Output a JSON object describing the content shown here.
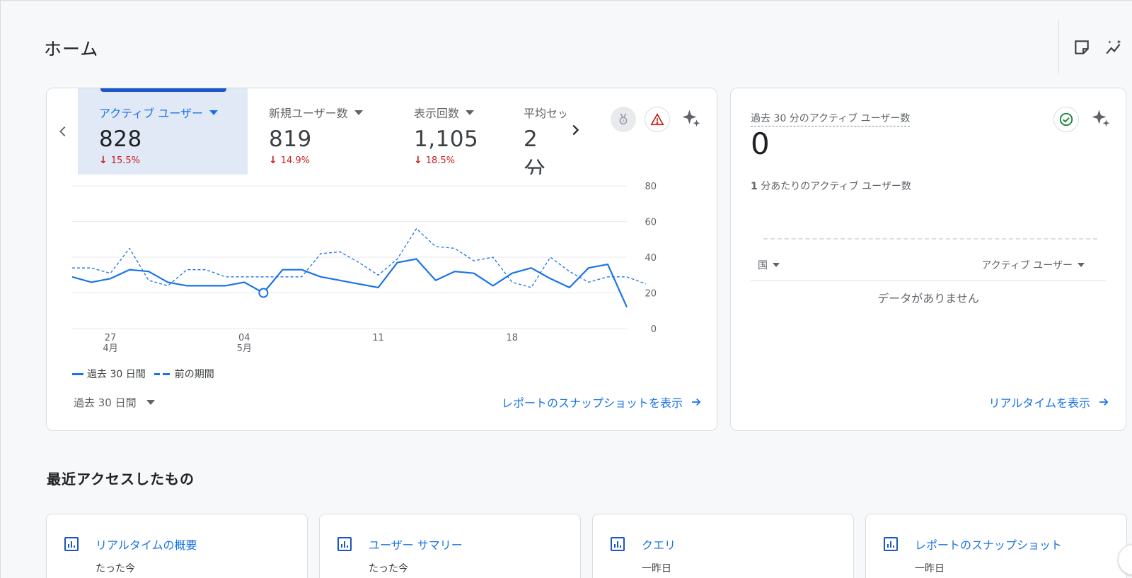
{
  "page": {
    "title": "ホーム"
  },
  "header_icons": [
    "note-icon",
    "insights-icon"
  ],
  "metrics": [
    {
      "label": "アクティブ ユーザー",
      "value": "828",
      "delta": "15.5%",
      "direction": "down",
      "active": true
    },
    {
      "label": "新規ユーザー数",
      "value": "819",
      "delta": "14.9%",
      "direction": "down"
    },
    {
      "label": "表示回数",
      "value": "1,105",
      "delta": "18.5%",
      "direction": "down"
    },
    {
      "label": "平均セッ",
      "value": "2 分",
      "delta": "-"
    }
  ],
  "chart_data": {
    "type": "line",
    "y_ticks": [
      "80",
      "60",
      "40",
      "20",
      "0"
    ],
    "ylim": [
      0,
      80
    ],
    "x_labels": [
      {
        "day": "27",
        "month": "4月"
      },
      {
        "day": "04",
        "month": "5月"
      },
      {
        "day": "11",
        "month": ""
      },
      {
        "day": "18",
        "month": ""
      }
    ],
    "series": [
      {
        "name": "過去 30 日間",
        "style": "solid",
        "values": [
          29,
          26,
          28,
          33,
          32,
          26,
          24,
          24,
          24,
          26,
          20,
          33,
          33,
          29,
          27,
          25,
          23,
          37,
          39,
          27,
          32,
          31,
          24,
          31,
          34,
          28,
          23,
          34,
          36,
          12
        ]
      },
      {
        "name": "前の期間",
        "style": "dashed",
        "values": [
          34,
          34,
          31,
          45,
          27,
          24,
          33,
          33,
          29,
          29,
          29,
          29,
          29,
          42,
          43,
          37,
          30,
          39,
          56,
          46,
          45,
          38,
          40,
          26,
          23,
          40,
          32,
          26,
          29,
          29,
          25
        ]
      }
    ],
    "highlight_index": 10,
    "legend": "bottom-left"
  },
  "period": {
    "label": "過去 30 日間"
  },
  "links": {
    "snapshot": "レポートのスナップショットを表示",
    "realtime": "リアルタイムを表示"
  },
  "realtime": {
    "title": "過去 30 分のアクティブ ユーザー数",
    "value": "0",
    "subtitle_bold": "1",
    "subtitle": " 分あたりのアクティブ ユーザー数",
    "col_country": "国",
    "col_users": "アクティブ ユーザー",
    "no_data": "データがありません"
  },
  "recent": {
    "title": "最近アクセスしたもの",
    "items": [
      {
        "title": "リアルタイムの概要",
        "time": "たった今"
      },
      {
        "title": "ユーザー サマリー",
        "time": "たった今"
      },
      {
        "title": "クエリ",
        "time": "一昨日"
      },
      {
        "title": "レポートのスナップショット",
        "time": "一昨日"
      }
    ]
  },
  "colors": {
    "accent": "#1a73e8",
    "negative": "#c5221f",
    "active_tab_bg": "#e1e9f7",
    "success": "#188038",
    "warning": "#c5221f"
  }
}
